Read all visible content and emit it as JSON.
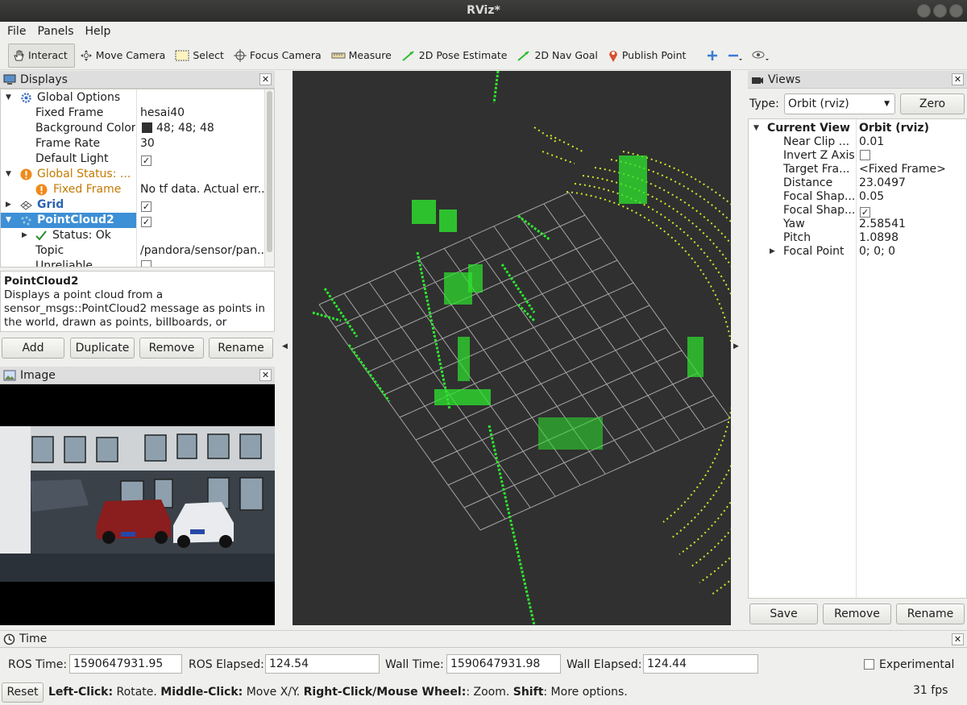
{
  "window": {
    "title": "RViz*"
  },
  "menu": [
    "File",
    "Panels",
    "Help"
  ],
  "toolbar": {
    "tools": [
      "Interact",
      "Move Camera",
      "Select",
      "Focus Camera",
      "Measure",
      "2D Pose Estimate",
      "2D Nav Goal",
      "Publish Point"
    ],
    "active": "Interact"
  },
  "displays": {
    "title": "Displays",
    "rows": [
      {
        "label": "Global Options",
        "value": ""
      },
      {
        "label": "Fixed Frame",
        "value": "hesai40"
      },
      {
        "label": "Background Color",
        "value": "48; 48; 48"
      },
      {
        "label": "Frame Rate",
        "value": "30"
      },
      {
        "label": "Default Light",
        "value": ""
      },
      {
        "label": "Global Status: ...",
        "value": ""
      },
      {
        "label": "Fixed Frame",
        "value": "No tf data.  Actual err..."
      },
      {
        "label": "Grid",
        "value": ""
      },
      {
        "label": "PointCloud2",
        "value": ""
      },
      {
        "label": "Status: Ok",
        "value": ""
      },
      {
        "label": "Topic",
        "value": "/pandora/sensor/pan..."
      },
      {
        "label": "Unreliable",
        "value": ""
      }
    ],
    "description_title": "PointCloud2",
    "description": "Displays a point cloud from a sensor_msgs::PointCloud2 message as points in the world, drawn as points, billboards, or",
    "buttons": [
      "Add",
      "Duplicate",
      "Remove",
      "Rename"
    ]
  },
  "image_panel": {
    "title": "Image"
  },
  "views": {
    "title": "Views",
    "type_label": "Type:",
    "type_value": "Orbit (rviz)",
    "zero_label": "Zero",
    "header_key": "Current View",
    "header_value": "Orbit (rviz)",
    "rows": [
      {
        "label": "Near Clip ...",
        "value": "0.01"
      },
      {
        "label": "Invert Z Axis",
        "value": ""
      },
      {
        "label": "Target Fra...",
        "value": "<Fixed Frame>"
      },
      {
        "label": "Distance",
        "value": "23.0497"
      },
      {
        "label": "Focal Shap...",
        "value": "0.05"
      },
      {
        "label": "Focal Shap...",
        "value": ""
      },
      {
        "label": "Yaw",
        "value": "2.58541"
      },
      {
        "label": "Pitch",
        "value": "1.0898"
      },
      {
        "label": "Focal Point",
        "value": "0; 0; 0"
      }
    ],
    "buttons": [
      "Save",
      "Remove",
      "Rename"
    ]
  },
  "time": {
    "title": "Time",
    "ros_time_label": "ROS Time:",
    "ros_time": "1590647931.95",
    "ros_elapsed_label": "ROS Elapsed:",
    "ros_elapsed": "124.54",
    "wall_time_label": "Wall Time:",
    "wall_time": "1590647931.98",
    "wall_elapsed_label": "Wall Elapsed:",
    "wall_elapsed": "124.44",
    "experimental_label": "Experimental"
  },
  "status": {
    "reset_label": "Reset",
    "hint_parts": [
      "Left-Click:",
      " Rotate. ",
      "Middle-Click:",
      " Move X/Y. ",
      "Right-Click/Mouse Wheel:",
      ": Zoom. ",
      "Shift",
      ": More options."
    ],
    "fps": "31 fps"
  },
  "colors": {
    "background": "#303030",
    "points_near": "#2ee62e",
    "points_far": "#d6e62a",
    "grid": "#a0a0a0",
    "selection": "#3d8fd6"
  }
}
